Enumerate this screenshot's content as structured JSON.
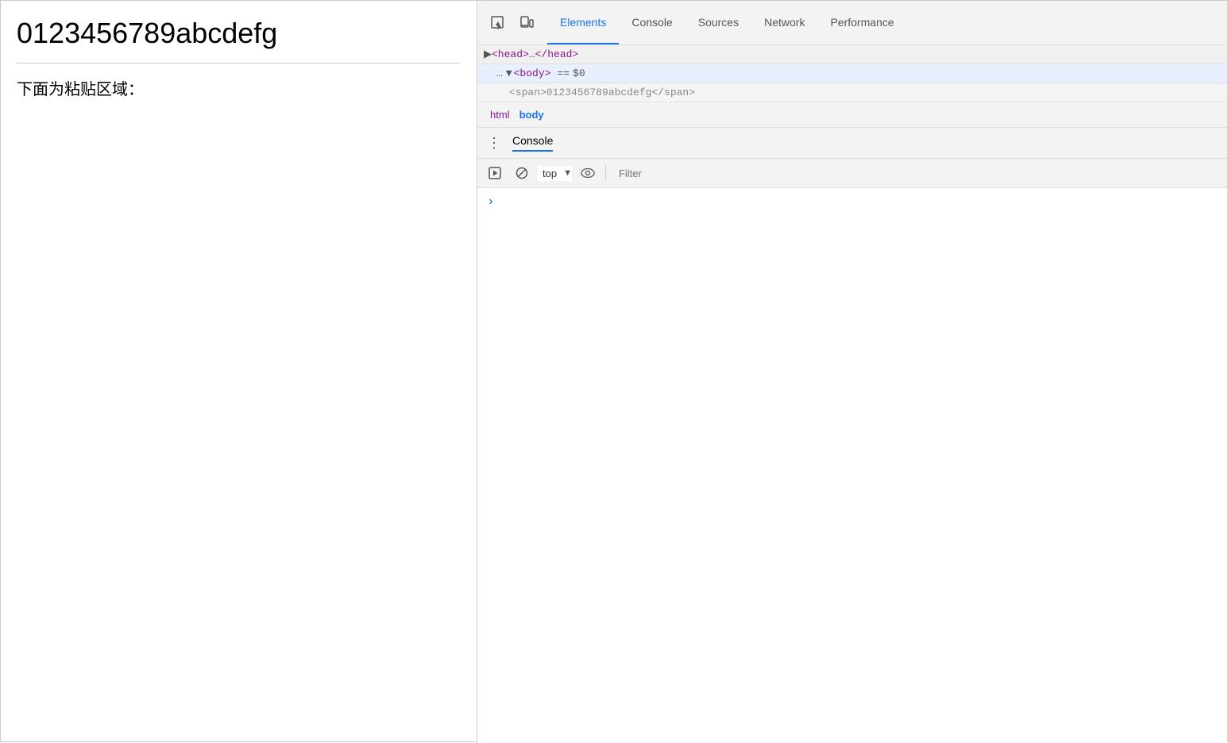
{
  "webpage": {
    "title": "0123456789abcdefg",
    "subtitle": "下面为粘贴区域："
  },
  "devtools": {
    "tabs": [
      {
        "id": "elements",
        "label": "Elements",
        "active": true
      },
      {
        "id": "console",
        "label": "Console",
        "active": false
      },
      {
        "id": "sources",
        "label": "Sources",
        "active": false
      },
      {
        "id": "network",
        "label": "Network",
        "active": false
      },
      {
        "id": "performance",
        "label": "Performance",
        "active": false
      }
    ],
    "elements_panel": {
      "head_line": "▶ <head>…</head>",
      "selected_line": "... ▼ <body> == $0",
      "snippet_line": "<span>0123456789abcdefg</span>"
    },
    "breadcrumb": {
      "items": [
        "html",
        "body"
      ]
    },
    "console_panel": {
      "title": "Console",
      "top_label": "top",
      "filter_placeholder": "Filter",
      "prompt": "›"
    }
  },
  "icons": {
    "inspect": "⬚",
    "device": "⬜",
    "play": "▶",
    "block": "⊘",
    "eye": "👁",
    "dots": "⋮"
  }
}
